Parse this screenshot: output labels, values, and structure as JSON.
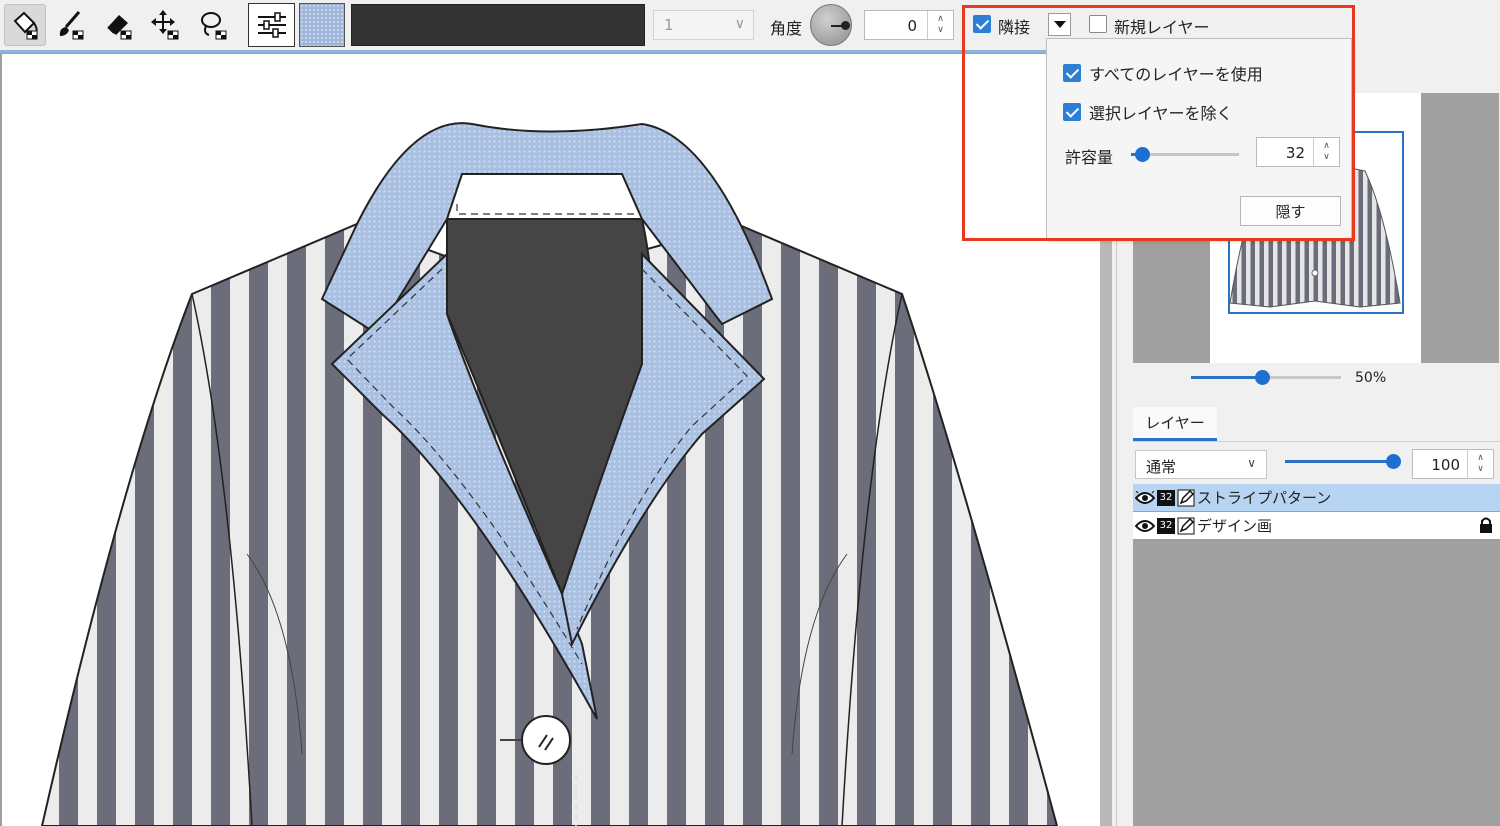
{
  "colors": {
    "accent": "#2d7fd3",
    "highlight": "#e8391f",
    "stripe_dark": "#6b6d7a",
    "stripe_light": "#ececec",
    "lapel_blue": "#a9c0e2",
    "inner_dark": "#454545"
  },
  "toolbar": {
    "tools": [
      "fill-bucket-icon",
      "brush-pattern-icon",
      "eraser-pattern-icon",
      "move-pattern-icon",
      "lasso-pattern-icon"
    ],
    "size_value": "1",
    "angle_label": "角度",
    "angle_value": "0",
    "adjacent_label": "隣接",
    "adjacent_checked": true,
    "new_layer_label": "新規レイヤー",
    "new_layer_checked": false
  },
  "popup": {
    "use_all_layers_label": "すべてのレイヤーを使用",
    "exclude_selected_label": "選択レイヤーを除く",
    "tolerance_label": "許容量",
    "tolerance_value": "32",
    "tolerance_fraction": 0.1,
    "hide_label": "隠す"
  },
  "navigator": {
    "zoom_label": "50%",
    "zoom_fraction": 0.47
  },
  "layers_panel": {
    "tab_label": "レイヤー",
    "blend_mode": "通常",
    "opacity_value": "100",
    "opacity_fraction": 1.0,
    "layers": [
      {
        "bit_depth": "32",
        "name": "ストライプパターン",
        "selected": true,
        "locked": false
      },
      {
        "bit_depth": "32",
        "name": "デザイン画",
        "selected": false,
        "locked": true
      }
    ]
  }
}
